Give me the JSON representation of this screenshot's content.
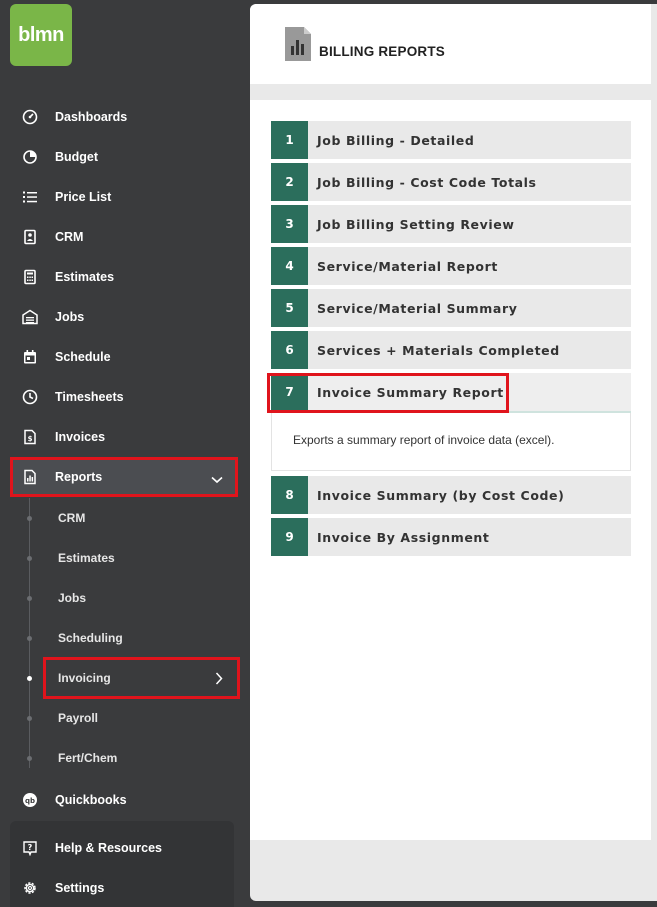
{
  "app": {
    "logo_text": "blmn",
    "brand_color": "#7ab648",
    "accent_color": "#2b6e5c",
    "highlight_color": "#e0141c"
  },
  "sidebar": {
    "items": [
      {
        "label": "Dashboards",
        "icon": "dashboard-icon"
      },
      {
        "label": "Budget",
        "icon": "pie-chart-icon"
      },
      {
        "label": "Price List",
        "icon": "list-icon"
      },
      {
        "label": "CRM",
        "icon": "contact-card-icon"
      },
      {
        "label": "Estimates",
        "icon": "calculator-icon"
      },
      {
        "label": "Jobs",
        "icon": "garage-icon"
      },
      {
        "label": "Schedule",
        "icon": "calendar-icon"
      },
      {
        "label": "Timesheets",
        "icon": "clock-icon"
      },
      {
        "label": "Invoices",
        "icon": "invoice-icon"
      },
      {
        "label": "Reports",
        "icon": "report-icon"
      }
    ],
    "reports_sub": [
      {
        "label": "CRM"
      },
      {
        "label": "Estimates"
      },
      {
        "label": "Jobs"
      },
      {
        "label": "Scheduling"
      },
      {
        "label": "Invoicing"
      },
      {
        "label": "Payroll"
      },
      {
        "label": "Fert/Chem"
      }
    ],
    "quickbooks": {
      "label": "Quickbooks",
      "icon": "quickbooks-icon"
    },
    "help": {
      "label": "Help & Resources",
      "icon": "help-icon"
    },
    "settings": {
      "label": "Settings",
      "icon": "gear-icon"
    }
  },
  "main": {
    "title": "BILLING REPORTS",
    "reports": [
      {
        "num": "1",
        "label": "Job Billing - Detailed"
      },
      {
        "num": "2",
        "label": "Job Billing - Cost Code Totals"
      },
      {
        "num": "3",
        "label": "Job Billing Setting Review"
      },
      {
        "num": "4",
        "label": "Service/Material Report"
      },
      {
        "num": "5",
        "label": "Service/Material Summary"
      },
      {
        "num": "6",
        "label": "Services + Materials Completed"
      },
      {
        "num": "7",
        "label": "Invoice Summary Report",
        "description": "Exports a summary report of invoice data (excel)."
      },
      {
        "num": "8",
        "label": "Invoice Summary (by Cost Code)"
      },
      {
        "num": "9",
        "label": "Invoice By Assignment"
      }
    ]
  }
}
